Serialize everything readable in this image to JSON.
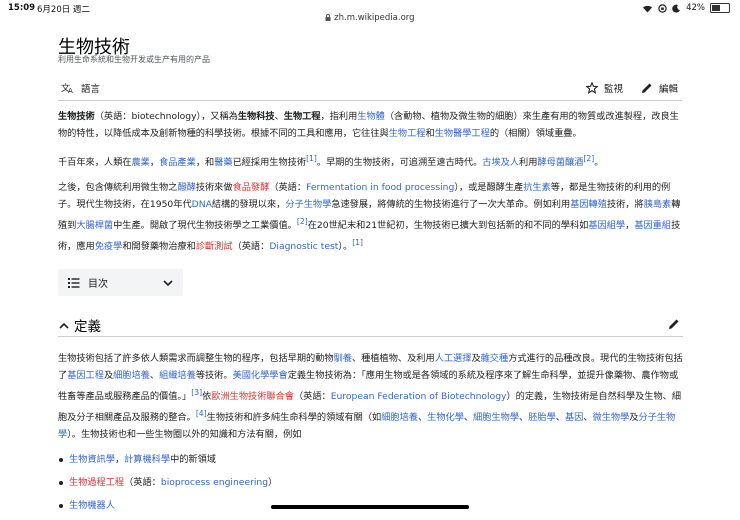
{
  "status": {
    "time": "15:09",
    "date": "6月20日 週二",
    "battery": "42%"
  },
  "url": "zh.m.wikipedia.org",
  "page": {
    "title": "生物技術",
    "subtitle": "利用生命系統和生物开发或生产有用的产品"
  },
  "toolbar": {
    "language": "語言",
    "watch": "監視",
    "edit": "編輯"
  },
  "toc": {
    "label": "目次"
  },
  "section": {
    "title": "定義"
  },
  "p1": {
    "a": "生物技術",
    "b": "（英語：biotechnology），又稱為",
    "c": "生物科技",
    "d": "、",
    "e": "生物工程",
    "f": "，指利用",
    "g": "生物體",
    "h": "（含動物、植物及微生物的細胞）來生產有用的物質或改進製程，改良生物的特性，以降低成本及創新物種的科學技術。根據不同的工具和應用，它往往與",
    "i": "生物工程",
    "j": "和",
    "k": "生物醫學工程",
    "l": "的（相關）領域重疊。"
  },
  "p2": {
    "a": "千百年來，人類在",
    "b": "農業",
    "c": "，",
    "d": "食品產業",
    "e": "，和",
    "f": "醫藥",
    "g": "已經採用生物技術",
    "h": "[1]",
    "i": "。早期的生物技術，可追溯至遠古時代。",
    "j": "古埃及人",
    "k": "利用",
    "l": "酵母菌釀酒",
    "m": "[2]",
    "n": "。"
  },
  "p3": {
    "a": "之後，包含傳統利用微生物之",
    "b": "醱酵",
    "c": "技術來做",
    "d": "食品發酵",
    "e": "（英語：",
    "f": "Fermentation in food processing",
    "g": "），或是醱酵生產",
    "h": "抗生素",
    "i": "等，都是生物技術的利用的例子。現代生物技術，在1950年代",
    "j": "DNA",
    "k": "結構的發現以來，",
    "l": "分子生物學",
    "m": "急速發展，將傳統的生物技術進行了一次大革命。例如利用",
    "n": "基因轉殖",
    "o": "技術，將",
    "p": "胰島素",
    "q": "轉殖到",
    "r": "大腸桿菌",
    "s": "中生產。開啟了現代生物技術學之工業價值。",
    "t": "[2]",
    "u": "在20世紀末和21世紀初，生物技術已擴大到包括新的和不同的學科如",
    "v": "基因組學",
    "w": "，",
    "x": "基因重組",
    "y": "技術，應用",
    "z": "免疫學",
    "aa": "和開發藥物治療和",
    "ab": "診斷測試",
    "ac": "（英語：",
    "ad": "Diagnostic test",
    "ae": "）。",
    "af": "[1]"
  },
  "p4": {
    "a": "生物技術包括了許多依人類需求而調整生物的程序，包括早期的動物",
    "b": "馴養",
    "c": "、種植植物、及利用",
    "d": "人工選擇",
    "e": "及",
    "f": "雜交種",
    "g": "方式進行的品種改良。現代的生物技術包括了",
    "h": "基因工程",
    "i": "及",
    "j": "細胞培養",
    "k": "、",
    "l": "組織培養",
    "m": "等技術。",
    "n": "美國化學學會",
    "o": "定義生物技術為：「應用生物或是各領域的系統及程序來了解生命科學，並提升像藥物、農作物或牲畜等產品或服務產品的價值。」",
    "p": "[3]",
    "q": "依",
    "r": "歐洲生物技術聯合會",
    "s": "（英語：",
    "t": "European Federation of Biotechnology",
    "u": "）的定義，生物技術是自然科學及生物、細胞及分子相關產品及服務的整合。",
    "v": "[4]",
    "w": "生物技術和許多純生命科學的領域有關（如",
    "x": "細胞培養",
    "y": "、",
    "z": "生物化學",
    "aa": "、",
    "ab": "細胞生物學",
    "ac": "、",
    "ad": "胚胎學",
    "ae": "、",
    "af": "基因",
    "ag": "、",
    "ah": "微生物學",
    "ai": "及",
    "aj": "分子生物學",
    "ak": "）。生物技術也和一些生物圈以外的知識和方法有關，例如"
  },
  "list": [
    {
      "a": "生物資訊學",
      "b": "，",
      "c": "計算機科學",
      "d": "中的新領域"
    },
    {
      "a": "生物過程工程",
      "b": "（英語：",
      "c": "bioprocess engineering",
      "d": "）"
    },
    {
      "a": "生物機器人"
    }
  ]
}
